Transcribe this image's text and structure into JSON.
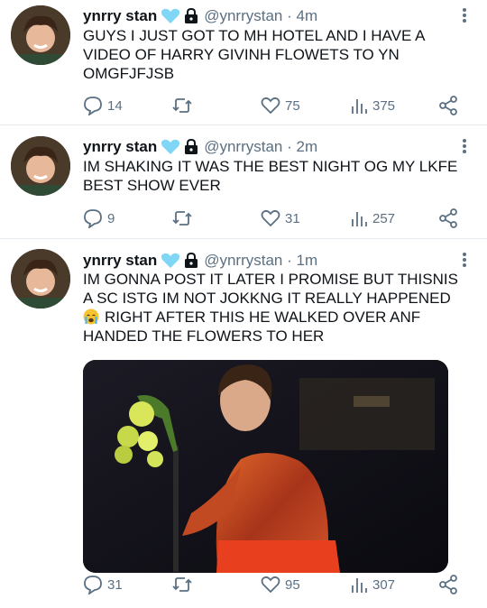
{
  "tweets": [
    {
      "name": "ynrry stan",
      "handle": "@ynrrystan",
      "time": "4m",
      "text": "GUYS I JUST GOT TO MH HOTEL AND I HAVE A VIDEO OF HARRY GIVINH FLOWETS TO YN OMGFJFJSB",
      "replies": "14",
      "retweets": "",
      "likes": "75",
      "views": "375"
    },
    {
      "name": "ynrry stan",
      "handle": "@ynrrystan",
      "time": "2m",
      "text": "IM SHAKING IT WAS THE BEST NIGHT OG MY LKFE BEST SHOW EVER",
      "replies": "9",
      "retweets": "",
      "likes": "31",
      "views": "257"
    },
    {
      "name": "ynrry stan",
      "handle": "@ynrrystan",
      "time": "1m",
      "text_line1": "IM GONNA POST IT LATER I PROMISE BUT THISNIS A SC ISTG IM NOT JOKKNG IT REALLY HAPPENED",
      "text_line2": "RIGHT AFTER THIS HE WALKED OVER ANF HANDED THE FLOWERS TO HER",
      "replies": "31",
      "retweets": "",
      "likes": "95",
      "views": "307"
    }
  ],
  "separator": "·",
  "colors": {
    "text": "#0f1419",
    "secondary": "#5b7083",
    "heart_emoji": "#7fd6f5"
  }
}
